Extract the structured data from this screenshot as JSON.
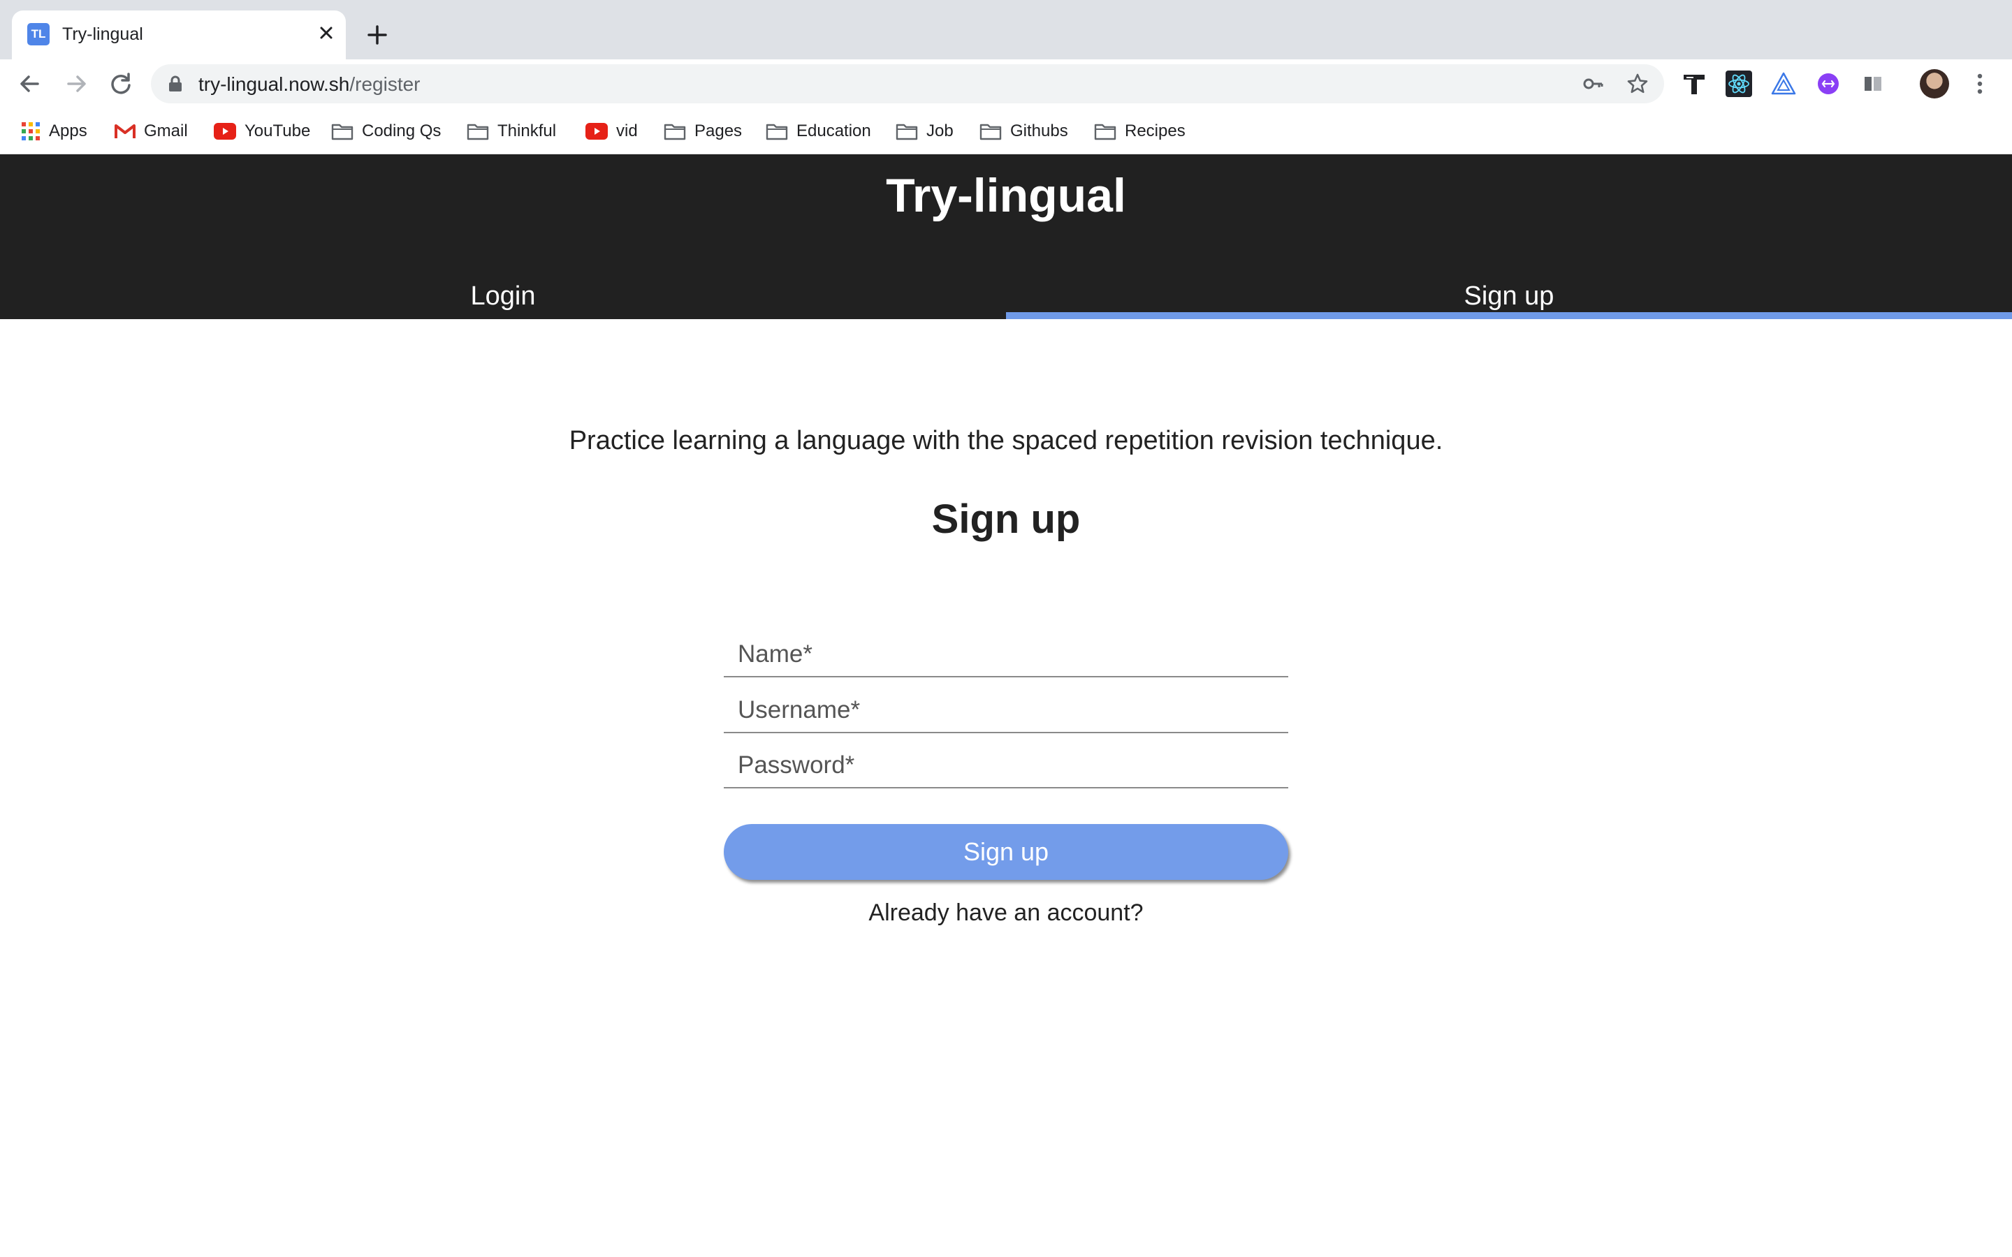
{
  "browser": {
    "tab": {
      "favicon_text": "TL",
      "title": "Try-lingual"
    },
    "url": {
      "host": "try-lingual.now.sh",
      "path": "/register"
    },
    "bookmarks": [
      {
        "label": "Apps",
        "icon": "apps-grid-icon"
      },
      {
        "label": "Gmail",
        "icon": "gmail-icon"
      },
      {
        "label": "YouTube",
        "icon": "youtube-icon"
      },
      {
        "label": "Coding Qs",
        "icon": "folder-icon"
      },
      {
        "label": "Thinkful",
        "icon": "folder-icon"
      },
      {
        "label": "vid",
        "icon": "youtube-icon"
      },
      {
        "label": "Pages",
        "icon": "folder-icon"
      },
      {
        "label": "Education",
        "icon": "folder-icon"
      },
      {
        "label": "Job",
        "icon": "folder-icon"
      },
      {
        "label": "Githubs",
        "icon": "folder-icon"
      },
      {
        "label": "Recipes",
        "icon": "folder-icon"
      }
    ]
  },
  "site": {
    "title": "Try-lingual",
    "nav": [
      {
        "label": "Login",
        "active": false
      },
      {
        "label": "Sign up",
        "active": true
      }
    ],
    "accent_color": "#6f9ae8",
    "header_color": "#212121"
  },
  "main": {
    "tagline": "Practice learning a language with the spaced repetition revision technique.",
    "form_title": "Sign up",
    "fields": [
      {
        "name": "name",
        "placeholder": "Name*"
      },
      {
        "name": "username",
        "placeholder": "Username*"
      },
      {
        "name": "password",
        "placeholder": "Password*"
      }
    ],
    "submit_label": "Sign up",
    "login_link": "Already have an account?"
  }
}
